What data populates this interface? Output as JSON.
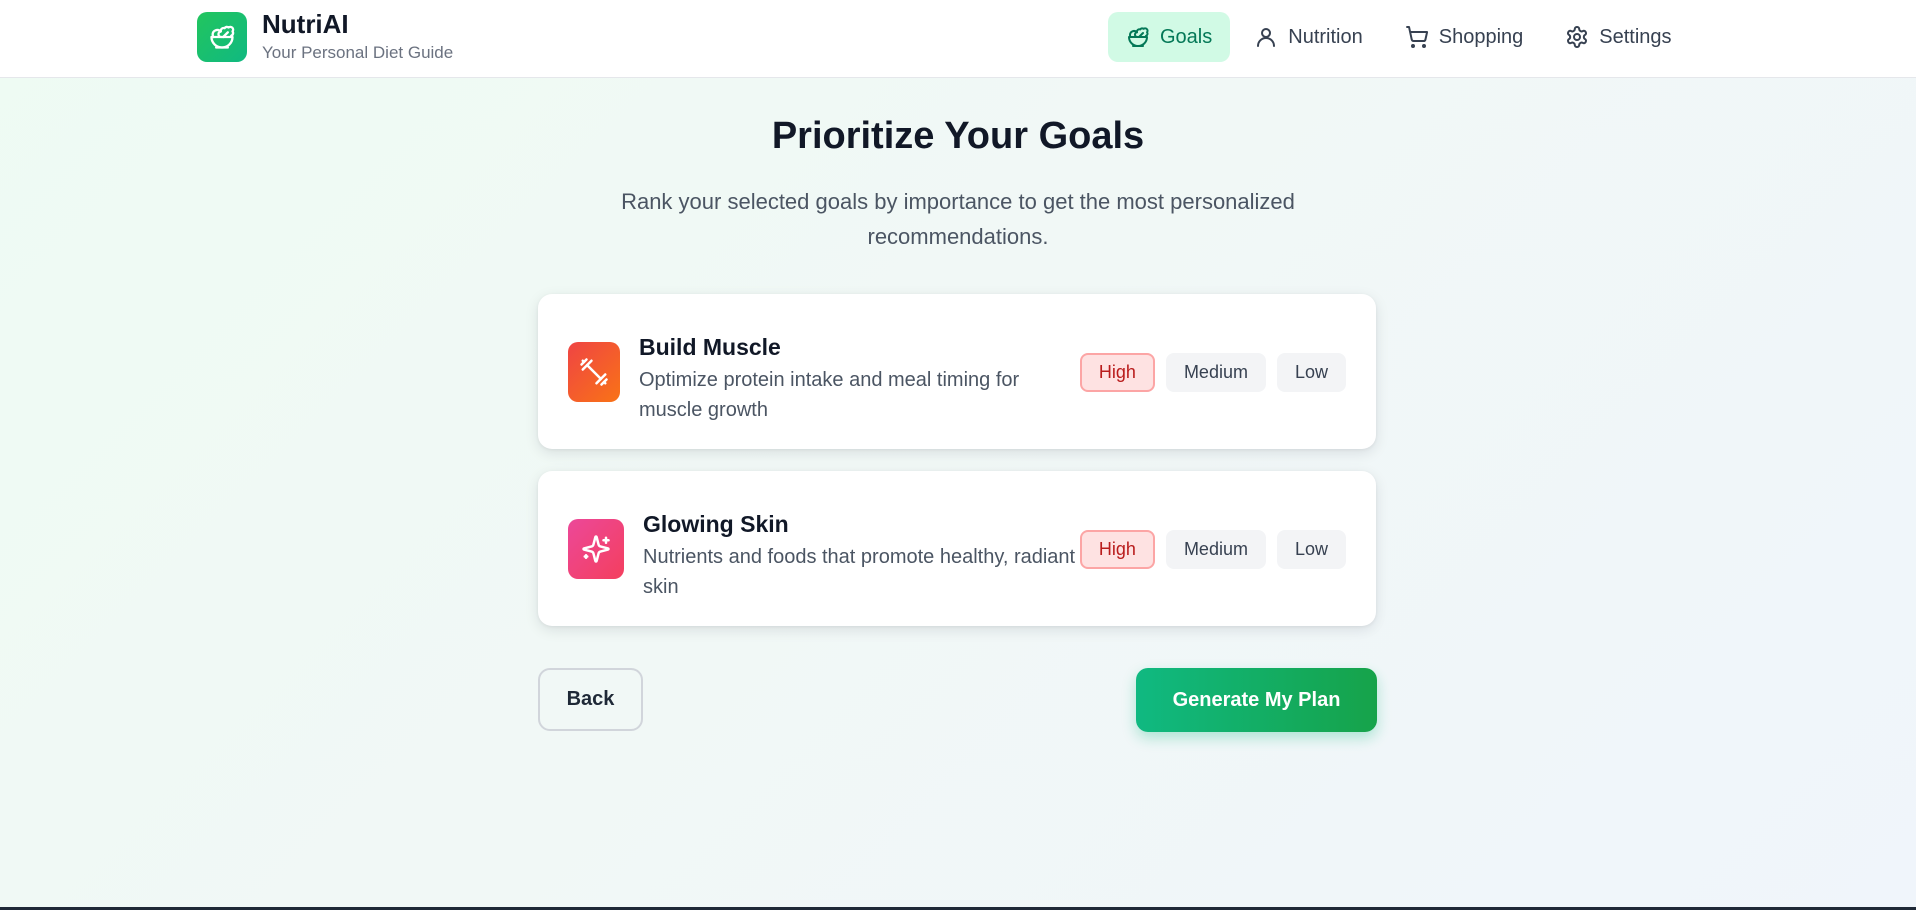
{
  "header": {
    "app_name": "NutriAI",
    "tagline": "Your Personal Diet Guide",
    "nav": [
      {
        "label": "Goals",
        "icon": "salad-bowl-icon",
        "active": true
      },
      {
        "label": "Nutrition",
        "icon": "user-icon",
        "active": false
      },
      {
        "label": "Shopping",
        "icon": "cart-icon",
        "active": false
      },
      {
        "label": "Settings",
        "icon": "gear-icon",
        "active": false
      }
    ]
  },
  "main": {
    "title": "Prioritize Your Goals",
    "subtitle": "Rank your selected goals by importance to get the most personalized recommendations.",
    "goals": [
      {
        "title": "Build Muscle",
        "description": "Optimize protein intake and meal timing for muscle growth",
        "icon": "dumbbell-icon",
        "icon_gradient": [
          "#ef4444",
          "#f97316"
        ],
        "priority_options": [
          "High",
          "Medium",
          "Low"
        ],
        "selected_priority": "High"
      },
      {
        "title": "Glowing Skin",
        "description": "Nutrients and foods that promote healthy, radiant skin",
        "icon": "sparkles-icon",
        "icon_gradient": [
          "#ec4899",
          "#f43f5e"
        ],
        "priority_options": [
          "High",
          "Medium",
          "Low"
        ],
        "selected_priority": "High"
      }
    ],
    "back_label": "Back",
    "generate_label": "Generate My Plan"
  },
  "colors": {
    "brand": "#10b981",
    "active_nav_bg": "#d1fae5",
    "selected_priority_bg": "#fee2e2",
    "selected_priority_text": "#b91c1c"
  }
}
